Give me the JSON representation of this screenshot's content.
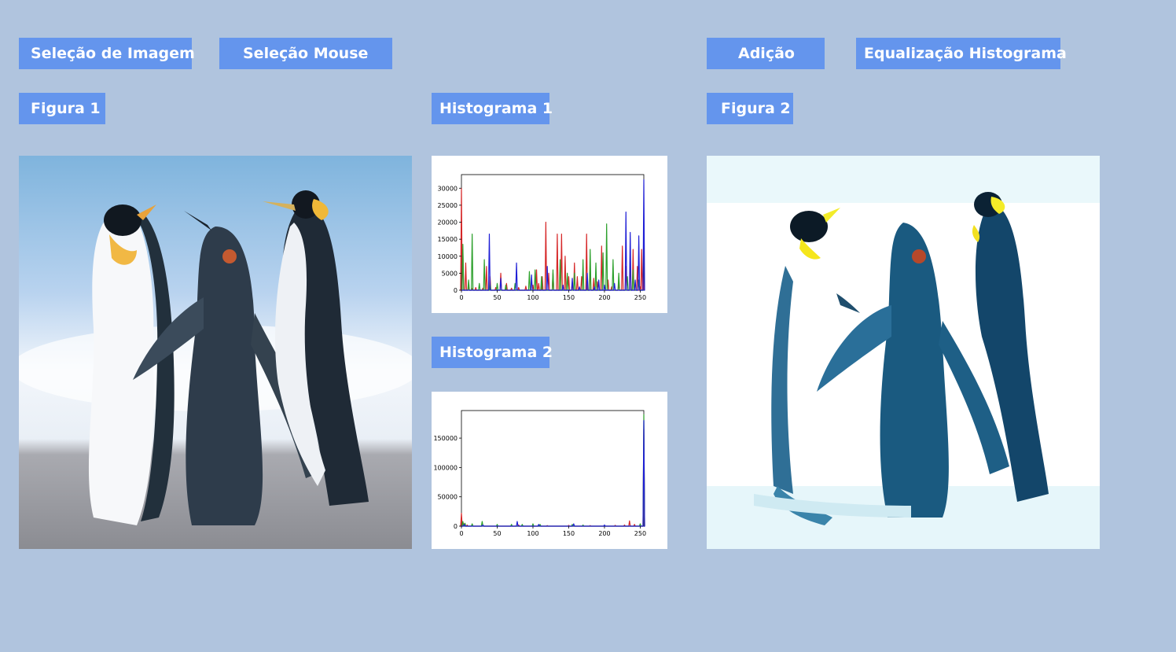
{
  "toolbar": {
    "image_selection": "Seleção de Imagem",
    "mouse_selection": "Seleção Mouse",
    "addition": "Adição",
    "histogram_equalization": "Equalização Histograma"
  },
  "labels": {
    "figure1": "Figura 1",
    "histogram1": "Histograma 1",
    "histogram2": "Histograma 2",
    "figure2": "Figura 2"
  },
  "colors": {
    "background": "#b0c4de",
    "button": "#6495ed",
    "button_text": "#ffffff",
    "series_red": "#d62728",
    "series_green": "#2ca02c",
    "series_blue": "#1f1fd6"
  },
  "images": {
    "figure1": "photo of three emperor penguins on a beach under a blue sky",
    "figure2": "processed penguin photo with a washed-out white background and dark-teal penguins"
  },
  "chart_data": [
    {
      "type": "line",
      "xlim": [
        0,
        255
      ],
      "ylim": [
        0,
        34000
      ],
      "xticks": [
        "0",
        "50",
        "100",
        "150",
        "200",
        "250"
      ],
      "yticks": [
        "0",
        "5000",
        "10000",
        "15000",
        "20000",
        "25000",
        "30000"
      ],
      "series": [
        {
          "color": "red",
          "points": [
            [
              0,
              30000
            ],
            [
              2,
              12000
            ],
            [
              6,
              8000
            ],
            [
              10,
              1000
            ],
            [
              15,
              500
            ],
            [
              20,
              800
            ],
            [
              30,
              600
            ],
            [
              35,
              7000
            ],
            [
              40,
              4000
            ],
            [
              48,
              800
            ],
            [
              55,
              5000
            ],
            [
              63,
              2000
            ],
            [
              70,
              600
            ],
            [
              80,
              800
            ],
            [
              90,
              1200
            ],
            [
              100,
              1500
            ],
            [
              105,
              6000
            ],
            [
              108,
              2000
            ],
            [
              113,
              4000
            ],
            [
              118,
              20000
            ],
            [
              122,
              5000
            ],
            [
              128,
              5000
            ],
            [
              134,
              16500
            ],
            [
              140,
              16500
            ],
            [
              145,
              10000
            ],
            [
              150,
              4000
            ],
            [
              155,
              2000
            ],
            [
              158,
              8000
            ],
            [
              162,
              4000
            ],
            [
              168,
              4000
            ],
            [
              175,
              16500
            ],
            [
              180,
              7000
            ],
            [
              185,
              3500
            ],
            [
              190,
              2500
            ],
            [
              196,
              13000
            ],
            [
              205,
              3000
            ],
            [
              210,
              1000
            ],
            [
              220,
              2000
            ],
            [
              225,
              13000
            ],
            [
              230,
              7000
            ],
            [
              236,
              10000
            ],
            [
              240,
              12000
            ],
            [
              246,
              7000
            ],
            [
              250,
              1000
            ],
            [
              252,
              12000
            ],
            [
              254,
              4000
            ]
          ]
        },
        {
          "color": "green",
          "points": [
            [
              2,
              13500
            ],
            [
              10,
              3000
            ],
            [
              15,
              16500
            ],
            [
              25,
              2000
            ],
            [
              32,
              9000
            ],
            [
              40,
              2000
            ],
            [
              50,
              2000
            ],
            [
              62,
              1500
            ],
            [
              75,
              2000
            ],
            [
              95,
              5500
            ],
            [
              103,
              6000
            ],
            [
              112,
              4000
            ],
            [
              128,
              6000
            ],
            [
              138,
              9000
            ],
            [
              148,
              5000
            ],
            [
              158,
              5000
            ],
            [
              170,
              9000
            ],
            [
              180,
              12000
            ],
            [
              188,
              8000
            ],
            [
              198,
              11000
            ],
            [
              203,
              19500
            ],
            [
              212,
              9000
            ],
            [
              220,
              5000
            ],
            [
              232,
              4000
            ],
            [
              240,
              6000
            ],
            [
              248,
              3000
            ]
          ]
        },
        {
          "color": "blue",
          "points": [
            [
              39,
              16500
            ],
            [
              55,
              3500
            ],
            [
              77,
              8000
            ],
            [
              98,
              4500
            ],
            [
              120,
              7000
            ],
            [
              142,
              1500
            ],
            [
              155,
              3500
            ],
            [
              165,
              1000
            ],
            [
              176,
              5000
            ],
            [
              186,
              1000
            ],
            [
              192,
              3000
            ],
            [
              200,
              1500
            ],
            [
              214,
              2000
            ],
            [
              230,
              23000
            ],
            [
              236,
              17000
            ],
            [
              243,
              3000
            ],
            [
              248,
              16000
            ],
            [
              255,
              32500
            ]
          ]
        }
      ]
    },
    {
      "type": "line",
      "xlim": [
        0,
        255
      ],
      "ylim": [
        0,
        197000
      ],
      "xticks": [
        "0",
        "50",
        "100",
        "150",
        "200",
        "250"
      ],
      "yticks": [
        "0",
        "50000",
        "100000",
        "150000"
      ],
      "series": [
        {
          "color": "red",
          "points": [
            [
              0,
              22000
            ],
            [
              3,
              5000
            ],
            [
              8,
              2000
            ],
            [
              15,
              3000
            ],
            [
              30,
              2000
            ],
            [
              50,
              1000
            ],
            [
              80,
              2000
            ],
            [
              100,
              1500
            ],
            [
              120,
              1000
            ],
            [
              150,
              1500
            ],
            [
              180,
              1000
            ],
            [
              200,
              1000
            ],
            [
              215,
              1500
            ],
            [
              228,
              2000
            ],
            [
              235,
              9000
            ],
            [
              242,
              3000
            ],
            [
              250,
              3000
            ],
            [
              255,
              165000
            ]
          ]
        },
        {
          "color": "green",
          "points": [
            [
              2,
              8000
            ],
            [
              5,
              5000
            ],
            [
              15,
              4000
            ],
            [
              29,
              8000
            ],
            [
              50,
              3000
            ],
            [
              70,
              3000
            ],
            [
              85,
              3000
            ],
            [
              100,
              4000
            ],
            [
              110,
              3000
            ],
            [
              155,
              3000
            ],
            [
              170,
              2000
            ],
            [
              250,
              4000
            ],
            [
              255,
              190000
            ]
          ]
        },
        {
          "color": "blue",
          "points": [
            [
              4,
              3000
            ],
            [
              30,
              2000
            ],
            [
              78,
              8000
            ],
            [
              108,
              3000
            ],
            [
              157,
              4000
            ],
            [
              200,
              2000
            ],
            [
              255,
              180000
            ]
          ]
        }
      ]
    }
  ]
}
